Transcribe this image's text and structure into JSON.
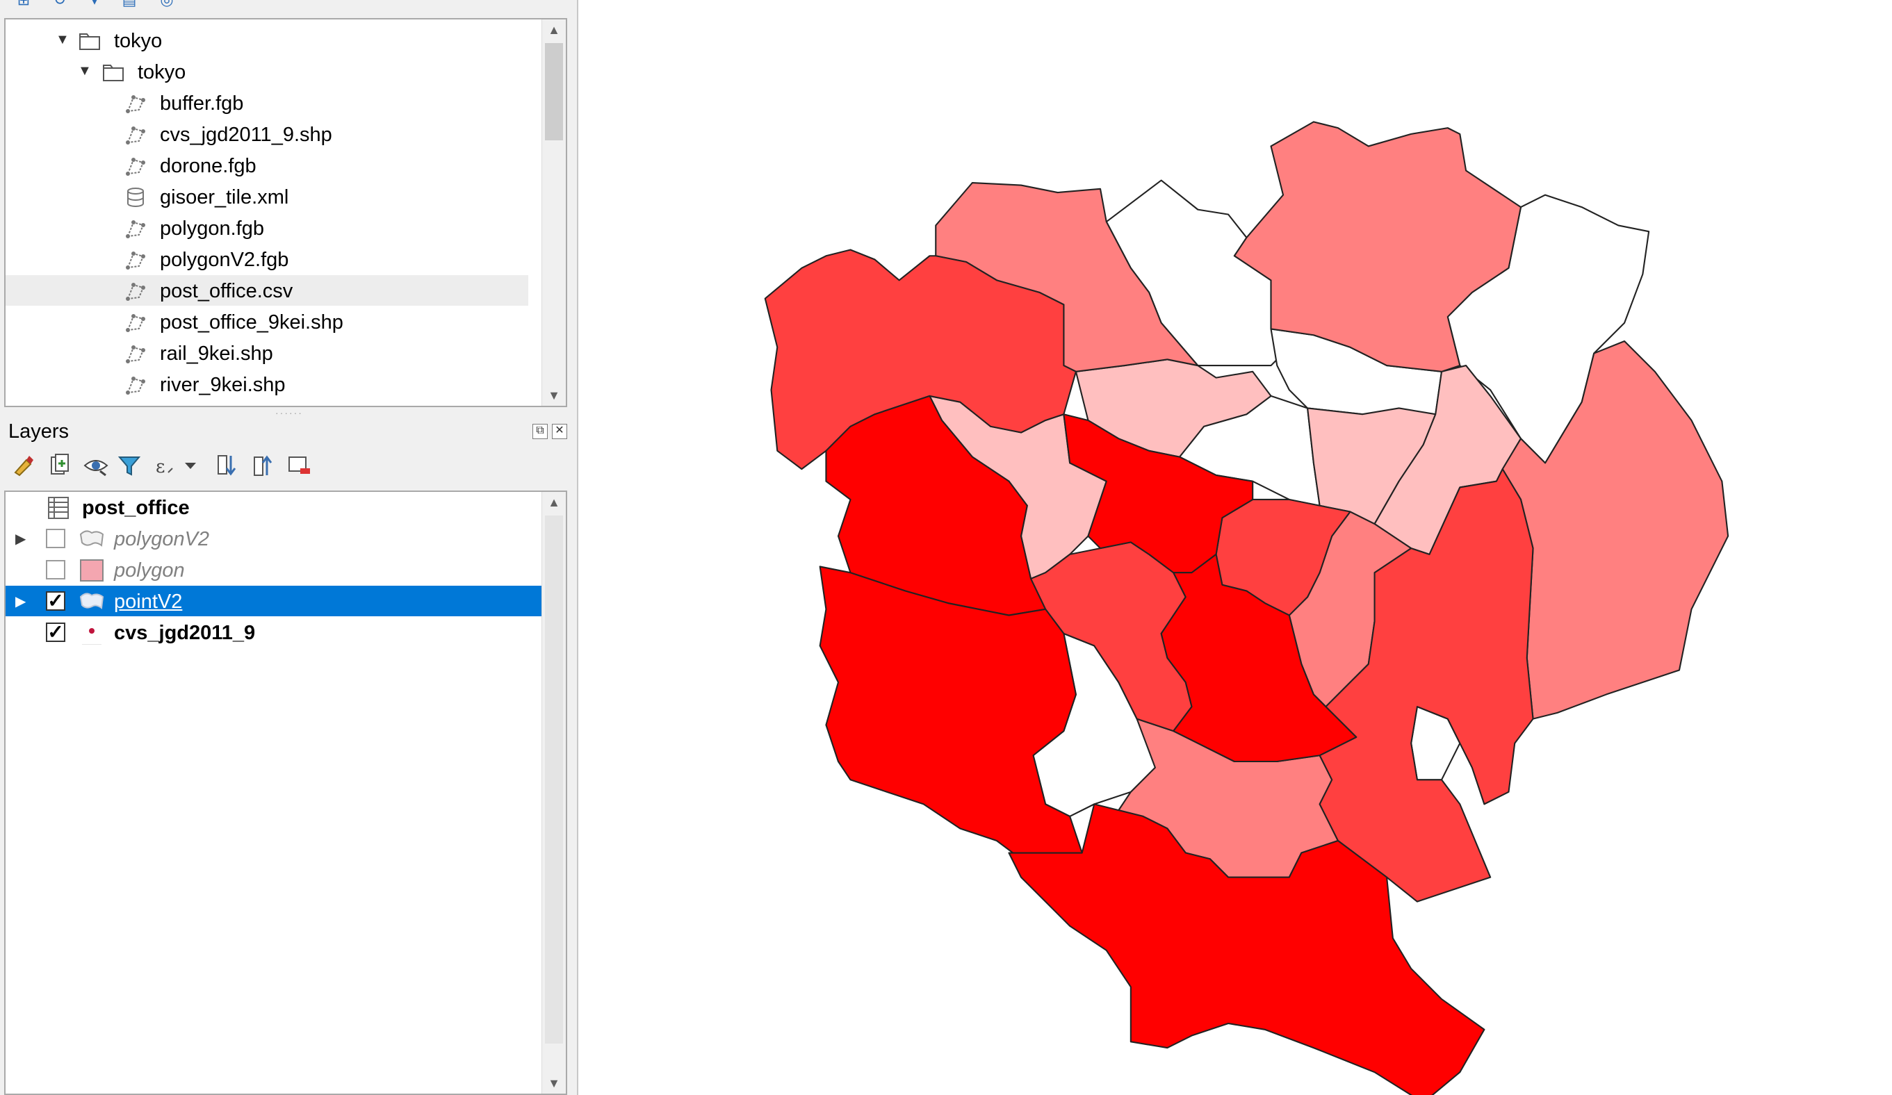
{
  "browser": {
    "items": [
      {
        "label": "tokyo",
        "icon": "folder-icon"
      },
      {
        "label": "tokyo",
        "icon": "folder-icon"
      },
      {
        "label": "buffer.fgb",
        "icon": "vector-layer-icon"
      },
      {
        "label": "cvs_jgd2011_9.shp",
        "icon": "vector-layer-icon"
      },
      {
        "label": "dorone.fgb",
        "icon": "vector-layer-icon"
      },
      {
        "label": "gisoer_tile.xml",
        "icon": "database-icon"
      },
      {
        "label": "polygon.fgb",
        "icon": "vector-layer-icon"
      },
      {
        "label": "polygonV2.fgb",
        "icon": "vector-layer-icon"
      },
      {
        "label": "post_office.csv",
        "icon": "vector-layer-icon"
      },
      {
        "label": "post_office_9kei.shp",
        "icon": "vector-layer-icon"
      },
      {
        "label": "rail_9kei.shp",
        "icon": "vector-layer-icon"
      },
      {
        "label": "river_9kei.shp",
        "icon": "vector-layer-icon"
      }
    ]
  },
  "layers_panel": {
    "title": "Layers",
    "toolbar": [
      "style-manager-icon",
      "add-group-icon",
      "manage-visibility-icon",
      "filter-legend-icon",
      "filter-expression-icon",
      "expand-all-icon",
      "collapse-all-icon",
      "remove-layer-icon"
    ],
    "layers": [
      {
        "name": "post_office",
        "checked": null,
        "symbol": "table-icon"
      },
      {
        "name": "polygonV2",
        "checked": false,
        "symbol": "polygon-icon"
      },
      {
        "name": "polygon",
        "checked": false,
        "symbol": "pink-fill-symbol"
      },
      {
        "name": "pointV2",
        "checked": true,
        "symbol": "polygon-icon",
        "selected": true
      },
      {
        "name": "cvs_jgd2011_9",
        "checked": true,
        "symbol": "point-symbol"
      }
    ]
  },
  "map": {
    "colors": {
      "class1": "#ffffff",
      "class2": "#ffbfbf",
      "class3": "#ff8080",
      "class4": "#ff4040",
      "class5": "#ff0000",
      "selection": "#0078d7"
    }
  }
}
